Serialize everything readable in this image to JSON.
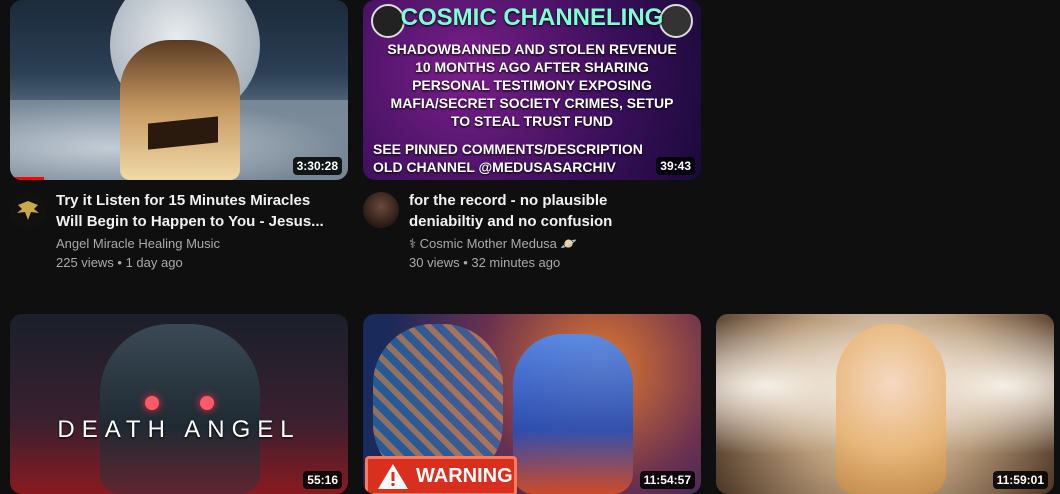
{
  "videos": [
    {
      "title": "Try it Listen for 15 Minutes Miracles Will Begin to Happen to You - Jesus...",
      "channel": "Angel Miracle Healing Music",
      "stats": "225 views • 1 day ago",
      "duration": "3:30:28",
      "watch_progress": 0.1
    },
    {
      "title": "for the record - no plausible deniabiltiy and no confusion",
      "channel": "⚕ Cosmic Mother Medusa 🪐",
      "stats": "30 views • 32 minutes ago",
      "duration": "39:43",
      "thumb_header": "COSMIC CHANNELING",
      "thumb_body": "SHADOWBANNED AND STOLEN REVENUE 10 MONTHS AGO AFTER SHARING PERSONAL TESTIMONY EXPOSING MAFIA/SECRET SOCIETY CRIMES, SETUP TO STEAL TRUST FUND",
      "thumb_footer": "SEE PINNED COMMENTS/DESCRIPTION OLD CHANNEL @MEDUSASARCHIV"
    }
  ],
  "row2": [
    {
      "thumb_text": "DEATH ANGEL",
      "duration": "55:16"
    },
    {
      "thumb_text": "WARNING",
      "duration": "11:54:57"
    },
    {
      "duration": "11:59:01"
    }
  ]
}
